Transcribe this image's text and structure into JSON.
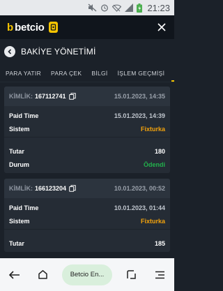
{
  "status_bar": {
    "time": "21:23",
    "icons": [
      "mute-icon",
      "alarm-icon",
      "wifi-icon",
      "signal-icon",
      "battery-icon"
    ]
  },
  "app": {
    "logo_text": "betcio",
    "logo_mark": "b"
  },
  "header": {
    "title": "BAKİYE YÖNETİMİ"
  },
  "tabs": [
    {
      "label": "PARA YATIR"
    },
    {
      "label": "PARA ÇEK"
    },
    {
      "label": "BİLGİ"
    },
    {
      "label": "İŞLEM GEÇMİŞİ"
    }
  ],
  "labels": {
    "id": "KİMLİK:",
    "paid_time": "Paid Time",
    "system": "Sistem",
    "amount": "Tutar",
    "status": "Durum"
  },
  "transactions": [
    {
      "id": "167112741",
      "date": "15.01.2023, 14:35",
      "paid_time": "15.01.2023, 14:39",
      "system": "Fixturka",
      "amount": "180",
      "status": "Ödendi"
    },
    {
      "id": "166123204",
      "date": "10.01.2023, 00:52",
      "paid_time": "10.01.2023, 01:44",
      "system": "Fixturka",
      "amount": "185",
      "status": ""
    }
  ],
  "nav": {
    "pill_label": "Betcio En..."
  },
  "colors": {
    "accent": "#f5c400",
    "system": "#f2a20c",
    "status_paid": "#22b14c",
    "background": "#1b2129"
  }
}
